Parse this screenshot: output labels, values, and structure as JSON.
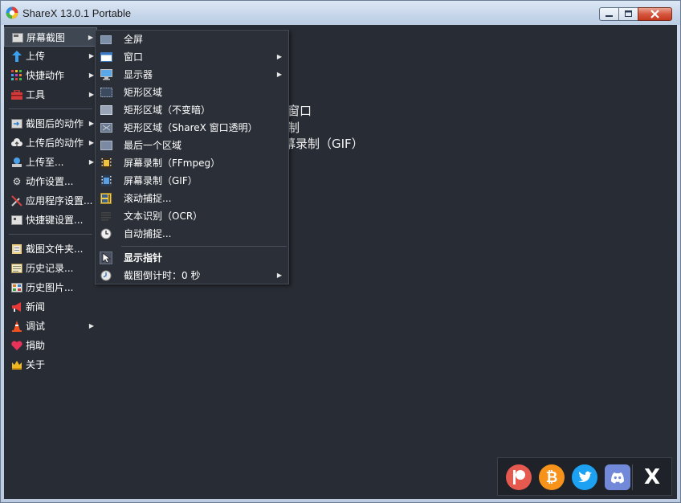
{
  "window": {
    "title": "ShareX 13.0.1 Portable"
  },
  "background_text": [
    "窗口",
    "制",
    "幕录制（GIF）"
  ],
  "menu": [
    {
      "label": "屏幕截图",
      "icon": "screenshot-icon",
      "arrow": true,
      "active": true
    },
    {
      "label": "上传",
      "icon": "upload-arrow-icon",
      "arrow": true
    },
    {
      "label": "快捷动作",
      "icon": "quick-actions-grid-icon",
      "arrow": true
    },
    {
      "label": "工具",
      "icon": "toolbox-icon",
      "arrow": true
    },
    {
      "label": "截图后的动作",
      "icon": "after-capture-icon",
      "arrow": true
    },
    {
      "label": "上传后的动作",
      "icon": "after-upload-cloud-icon",
      "arrow": true
    },
    {
      "label": "上传至...",
      "icon": "upload-destination-icon",
      "arrow": true
    },
    {
      "label": "动作设置...",
      "icon": "gear-icon",
      "arrow": false
    },
    {
      "label": "应用程序设置...",
      "icon": "wrench-screwdriver-icon",
      "arrow": false
    },
    {
      "label": "快捷键设置...",
      "icon": "keyboard-icon",
      "arrow": false
    },
    {
      "label": "截图文件夹...",
      "icon": "folder-icon",
      "arrow": false
    },
    {
      "label": "历史记录...",
      "icon": "history-icon",
      "arrow": false
    },
    {
      "label": "历史图片...",
      "icon": "image-history-icon",
      "arrow": false
    },
    {
      "label": "新闻",
      "icon": "megaphone-icon",
      "arrow": false
    },
    {
      "label": "调试",
      "icon": "traffic-cone-icon",
      "arrow": true
    },
    {
      "label": "捐助",
      "icon": "heart-icon",
      "arrow": false
    },
    {
      "label": "关于",
      "icon": "crown-icon",
      "arrow": false
    }
  ],
  "submenu": [
    {
      "label": "全屏",
      "icon": "fullscreen-icon",
      "arrow": false
    },
    {
      "label": "窗口",
      "icon": "window-icon",
      "arrow": true
    },
    {
      "label": "显示器",
      "icon": "monitor-icon",
      "arrow": true
    },
    {
      "label": "矩形区域",
      "icon": "rectangle-region-icon",
      "arrow": false
    },
    {
      "label": "矩形区域（不变暗）",
      "icon": "rectangle-light-icon",
      "arrow": false
    },
    {
      "label": "矩形区域（ShareX 窗口透明）",
      "icon": "rectangle-transparent-icon",
      "arrow": false
    },
    {
      "label": "最后一个区域",
      "icon": "last-region-icon",
      "arrow": false
    },
    {
      "label": "屏幕录制（FFmpeg）",
      "icon": "film-icon",
      "arrow": false
    },
    {
      "label": "屏幕录制（GIF）",
      "icon": "gif-film-icon",
      "arrow": false
    },
    {
      "label": "滚动捕捉...",
      "icon": "scrolling-capture-icon",
      "arrow": false
    },
    {
      "label": "文本识别（OCR）",
      "icon": "ocr-icon",
      "arrow": false
    },
    {
      "label": "自动捕捉...",
      "icon": "clock-icon",
      "arrow": false
    },
    {
      "label": "显示指针",
      "icon": "cursor-icon",
      "arrow": false,
      "checked": true,
      "bold": true
    },
    {
      "label": "截图倒计时：0 秒",
      "icon": "timer-icon",
      "arrow": true
    }
  ],
  "social": [
    "patreon-icon",
    "bitcoin-icon",
    "twitter-icon",
    "discord-icon",
    "x-logo-icon"
  ],
  "colors": {
    "background": "#282c34",
    "patreon": "#e5594e",
    "bitcoin": "#f7931a",
    "twitter": "#1da1f2",
    "discord": "#7289da"
  }
}
